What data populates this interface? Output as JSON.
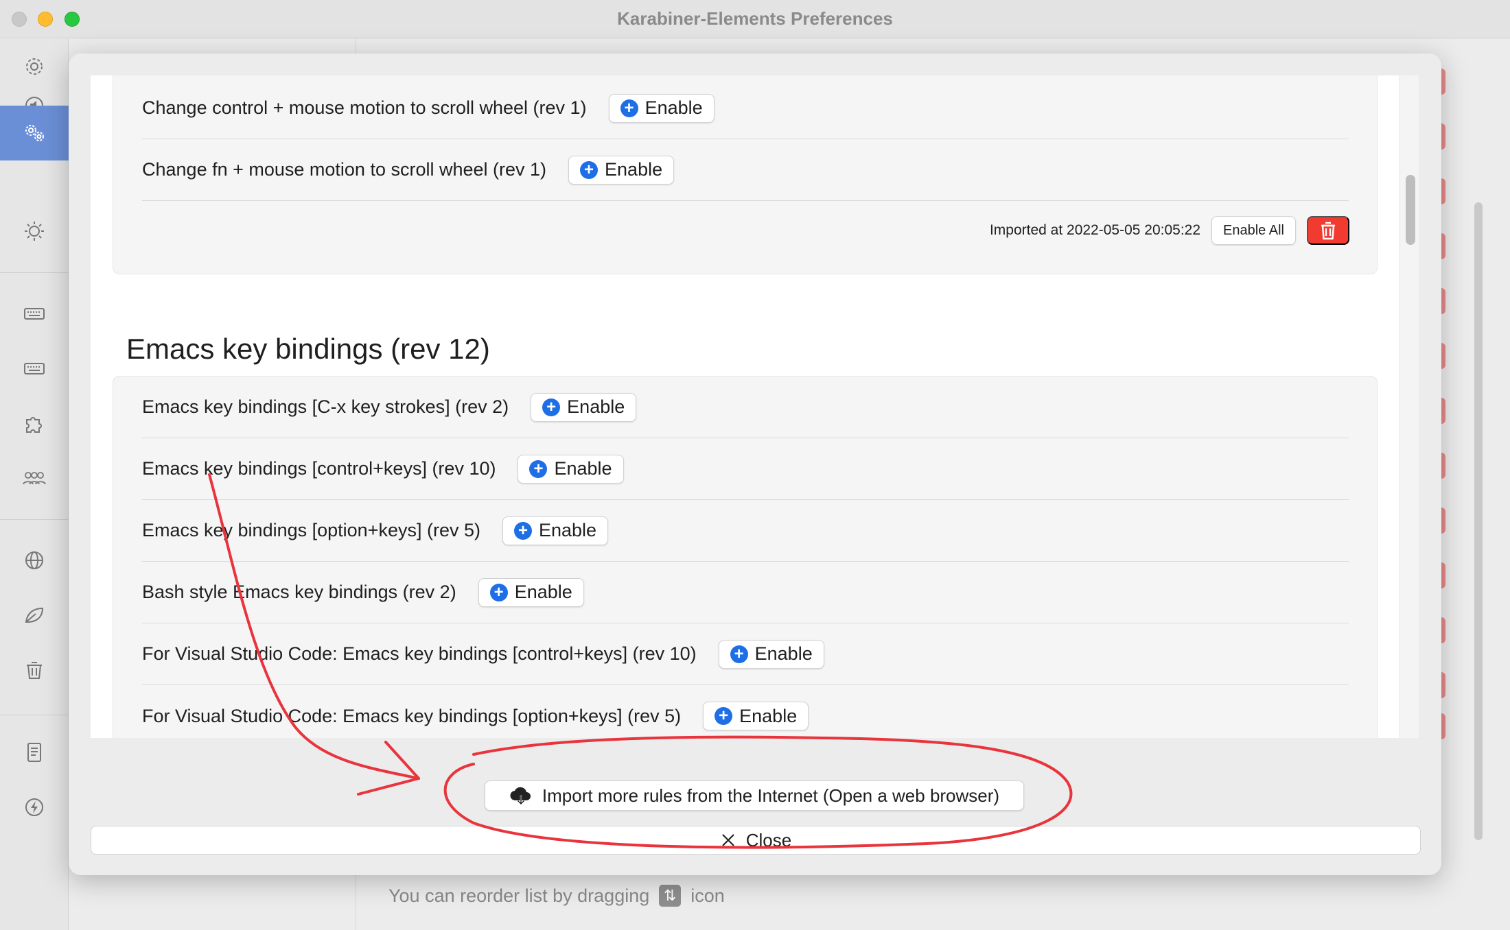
{
  "window": {
    "title": "Karabiner-Elements Preferences"
  },
  "sidebar": {
    "items": [
      {
        "icon": "gear-icon"
      },
      {
        "icon": "speaker-icon"
      },
      {
        "icon": "gears-icon",
        "selected": true
      },
      {
        "icon": "brightness-icon"
      },
      {
        "icon": "keyboard-icon"
      },
      {
        "icon": "keyboard-alt-icon"
      },
      {
        "icon": "puzzle-icon"
      },
      {
        "icon": "people-icon"
      },
      {
        "icon": "globe-icon"
      },
      {
        "icon": "leaf-icon"
      },
      {
        "icon": "trash-icon"
      },
      {
        "icon": "log-icon"
      },
      {
        "icon": "bolt-icon"
      }
    ]
  },
  "background": {
    "reorder_hint_prefix": "You can reorder list by dragging",
    "reorder_hint_suffix": "icon",
    "reorder_icon_glyph": "⇅"
  },
  "sheet": {
    "group1": {
      "rules": [
        {
          "label": "Change control + mouse motion to scroll wheel (rev 1)",
          "button": "Enable"
        },
        {
          "label": "Change fn + mouse motion to scroll wheel (rev 1)",
          "button": "Enable"
        }
      ],
      "imported_at": "Imported at 2022-05-05 20:05:22",
      "enable_all": "Enable All"
    },
    "section_title": "Emacs key bindings (rev 12)",
    "group2": {
      "rules": [
        {
          "label": "Emacs key bindings [C-x key strokes] (rev 2)",
          "button": "Enable"
        },
        {
          "label": "Emacs key bindings [control+keys] (rev 10)",
          "button": "Enable"
        },
        {
          "label": "Emacs key bindings [option+keys] (rev 5)",
          "button": "Enable"
        },
        {
          "label": "Bash style Emacs key bindings (rev 2)",
          "button": "Enable"
        },
        {
          "label": "For Visual Studio Code: Emacs key bindings [control+keys] (rev 10)",
          "button": "Enable"
        },
        {
          "label": "For Visual Studio Code: Emacs key bindings [option+keys] (rev 5)",
          "button": "Enable"
        }
      ]
    },
    "import_button": "Import more rules from the Internet (Open a web browser)",
    "close_button": "Close"
  },
  "colors": {
    "accent_blue": "#1e6ee6",
    "delete_red": "#f23b30",
    "annotation_red": "#e8343c",
    "sidebar_selected": "#6b8fd6"
  }
}
